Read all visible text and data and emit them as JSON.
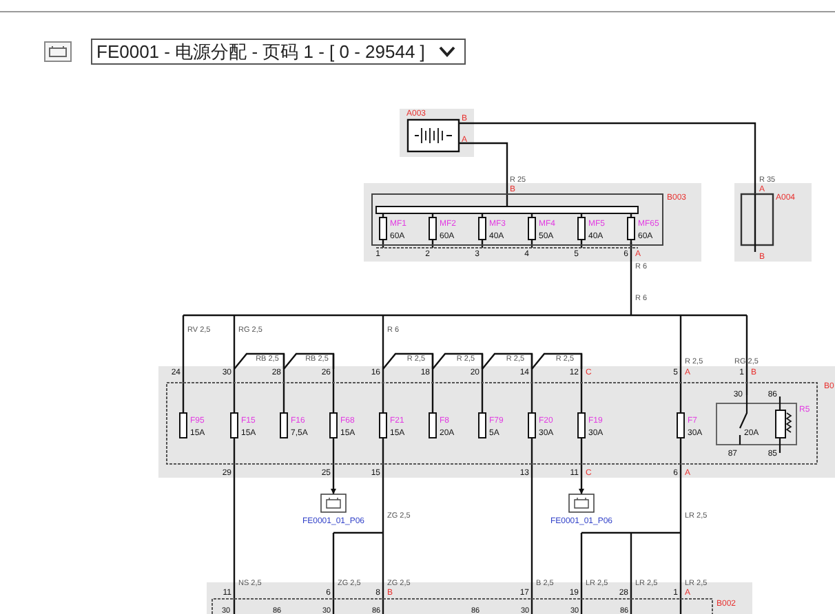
{
  "header": {
    "dropdown": {
      "value": "FE0001 - 电源分配 - 页码 1 - [ 0 - 29544 ]"
    }
  },
  "battery": {
    "name": "A003",
    "pins": [
      "B",
      "A"
    ]
  },
  "b003": {
    "name": "B003",
    "input_wire": "R 25",
    "input_pin": "B",
    "output_wires": [
      "R 6",
      "R 6"
    ],
    "fuses": [
      {
        "name": "MF1",
        "rating": "60A",
        "pin": "1"
      },
      {
        "name": "MF2",
        "rating": "60A",
        "pin": "2"
      },
      {
        "name": "MF3",
        "rating": "40A",
        "pin": "3"
      },
      {
        "name": "MF4",
        "rating": "50A",
        "pin": "4"
      },
      {
        "name": "MF5",
        "rating": "40A",
        "pin": "5"
      },
      {
        "name": "MF65",
        "rating": "60A",
        "pin": "6",
        "letter": "A"
      }
    ]
  },
  "a004": {
    "name": "A004",
    "wire": "R 35",
    "pins": [
      "A",
      "B"
    ]
  },
  "fuse_box": {
    "name": "B0",
    "feed_wires": [
      "RV 2,5",
      "RG 2,5",
      "R 6",
      "R 2,5",
      "RG 2,5"
    ],
    "jumper_wires": [
      "RB 2,5",
      "RB 2,5",
      "R 2,5",
      "R 2,5",
      "R 2,5",
      "R 2,5"
    ],
    "top_pins": [
      {
        "number": "24"
      },
      {
        "number": "30"
      },
      {
        "number": "28"
      },
      {
        "number": "26"
      },
      {
        "number": "16"
      },
      {
        "number": "18"
      },
      {
        "number": "20"
      },
      {
        "number": "14"
      },
      {
        "number": "12",
        "letter": "C"
      },
      {
        "number": "5",
        "letter": "A"
      },
      {
        "number": "1",
        "letter": "B"
      }
    ],
    "fuses": [
      {
        "name": "F95",
        "rating": "15A"
      },
      {
        "name": "F15",
        "rating": "15A"
      },
      {
        "name": "F16",
        "rating": "7,5A"
      },
      {
        "name": "F68",
        "rating": "15A"
      },
      {
        "name": "F21",
        "rating": "15A"
      },
      {
        "name": "F8",
        "rating": "20A"
      },
      {
        "name": "F79",
        "rating": "5A"
      },
      {
        "name": "F20",
        "rating": "30A"
      },
      {
        "name": "F19",
        "rating": "30A"
      },
      {
        "name": "F7",
        "rating": "30A"
      }
    ],
    "bottom_pins": [
      {
        "number": "29"
      },
      {
        "number": "25"
      },
      {
        "number": "15"
      },
      {
        "number": "13"
      },
      {
        "number": "11",
        "letter": "C"
      },
      {
        "number": "6",
        "letter": "A"
      }
    ],
    "relay": {
      "name": "R5",
      "rating": "20A",
      "pins": [
        "30",
        "86",
        "87",
        "85"
      ]
    }
  },
  "connector_refs": [
    "FE0001_01_P06",
    "FE0001_01_P06"
  ],
  "mid_wires": [
    "ZG 2,5",
    "LR 2,5"
  ],
  "b002": {
    "name": "B002",
    "wires": [
      "NS 2,5",
      "ZG 2,5",
      "ZG 2,5",
      "B 2,5",
      "LR 2,5",
      "LR 2,5",
      "LR 2,5"
    ],
    "pins": [
      {
        "number": "11"
      },
      {
        "number": "6"
      },
      {
        "number": "8",
        "letter": "B"
      },
      {
        "number": "17"
      },
      {
        "number": "19"
      },
      {
        "number": "28"
      },
      {
        "number": "1",
        "letter": "A"
      }
    ],
    "relay_pins": [
      "30",
      "86",
      "30",
      "86",
      "86",
      "30",
      "30",
      "86"
    ]
  }
}
